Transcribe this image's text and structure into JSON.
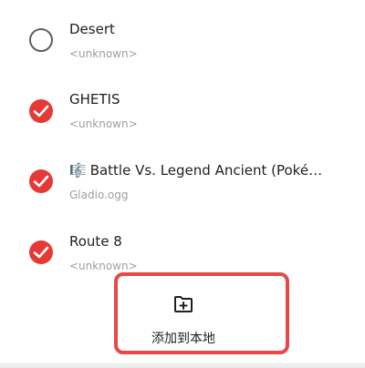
{
  "tracks": [
    {
      "title": "Desert",
      "subtitle": "<unknown>",
      "selected": false
    },
    {
      "title": "GHETIS",
      "subtitle": "<unknown>",
      "selected": true
    },
    {
      "title": "Battle Vs. Legend Ancient (Pokémo…",
      "subtitle": "Gladio.ogg",
      "selected": true,
      "icon": "music-note-icon"
    },
    {
      "title": "Route 8",
      "subtitle": "<unknown>",
      "selected": true
    }
  ],
  "action": {
    "label": "添加到本地",
    "icon": "folder-add-icon"
  },
  "colors": {
    "accent": "#e53935",
    "highlight_border": "#e84848",
    "subtitle": "#9e9e9e"
  }
}
